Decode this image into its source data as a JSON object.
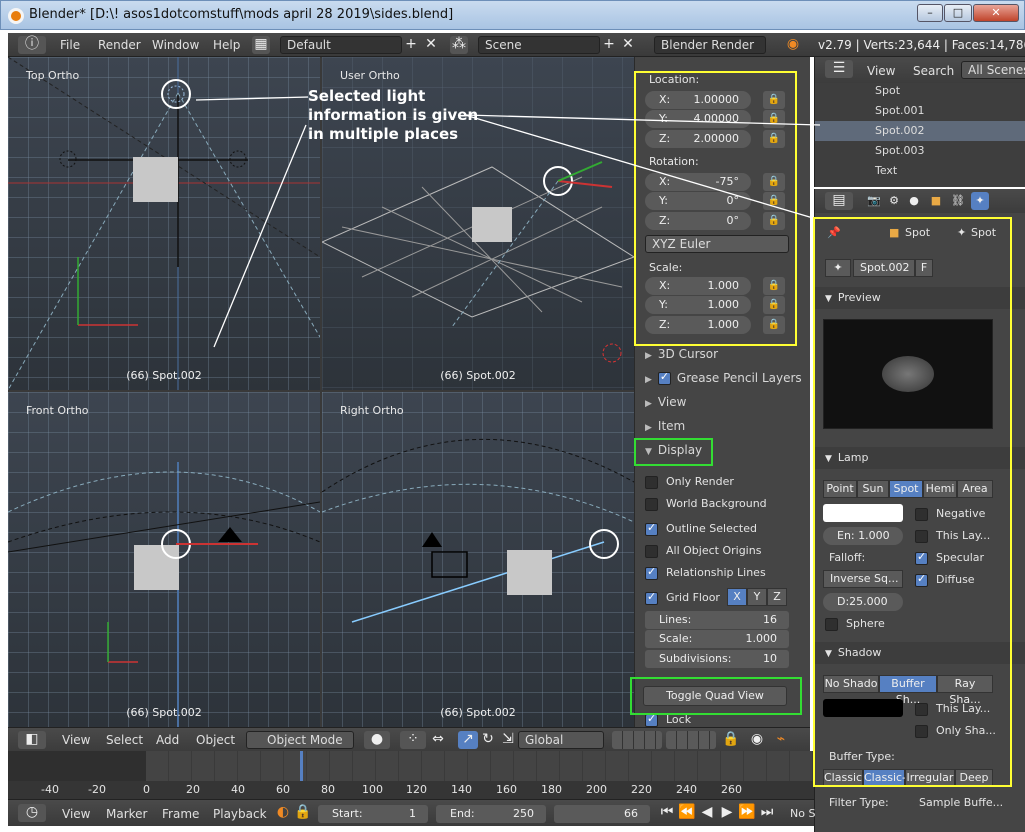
{
  "window": {
    "title": "Blender* [D:\\! asos1dotcomstuff\\mods april 28 2019\\sides.blend]"
  },
  "menubar": {
    "file": "File",
    "render": "Render",
    "window": "Window",
    "help": "Help",
    "layout": "Default",
    "scene": "Scene",
    "engine": "Blender Render",
    "stats": "v2.79 | Verts:23,644 | Faces:14,786 | Tri"
  },
  "viewports": {
    "top": "Top Ortho",
    "user": "User Ortho",
    "front": "Front Ortho",
    "right": "Right Ortho",
    "object_label": "(66) Spot.002"
  },
  "annotation": [
    "Selected light",
    "information is given",
    "in multiple places"
  ],
  "npanel": {
    "location_label": "Location:",
    "loc": [
      {
        "k": "X:",
        "v": "1.00000"
      },
      {
        "k": "Y:",
        "v": "4.00000"
      },
      {
        "k": "Z:",
        "v": "2.00000"
      }
    ],
    "rotation_label": "Rotation:",
    "rot": [
      {
        "k": "X:",
        "v": "-75°"
      },
      {
        "k": "Y:",
        "v": "0°"
      },
      {
        "k": "Z:",
        "v": "0°"
      }
    ],
    "rotation_mode": "XYZ Euler",
    "scale_label": "Scale:",
    "scale": [
      {
        "k": "X:",
        "v": "1.000"
      },
      {
        "k": "Y:",
        "v": "1.000"
      },
      {
        "k": "Z:",
        "v": "1.000"
      }
    ],
    "sections": {
      "cursor": "3D Cursor",
      "grease": "Grease Pencil Layers",
      "view": "View",
      "item": "Item",
      "display": "Display"
    },
    "display": {
      "only_render": "Only Render",
      "world_bg": "World Background",
      "outline": "Outline Selected",
      "all_origins": "All Object Origins",
      "rel_lines": "Relationship Lines",
      "grid_floor": "Grid Floor",
      "x": "X",
      "y": "Y",
      "z": "Z"
    },
    "lines_k": "Lines:",
    "lines_v": "16",
    "scale_k": "Scale:",
    "scale_v": "1.000",
    "subdiv_k": "Subdivisions:",
    "subdiv_v": "10",
    "toggle_quad": "Toggle Quad View",
    "lock": "Lock"
  },
  "outliner": {
    "view": "View",
    "search": "Search",
    "all_scenes": "All Scenes",
    "items": [
      "Spot",
      "Spot.001",
      "Spot.002",
      "Spot.003",
      "Text"
    ]
  },
  "props": {
    "crumb1": "Spot",
    "crumb2": "Spot",
    "datablock": "Spot.002",
    "fake": "F",
    "preview": "Preview",
    "lamp": "Lamp",
    "lamp_types": [
      "Point",
      "Sun",
      "Spot",
      "Hemi",
      "Area"
    ],
    "negative": "Negative",
    "this_layer": "This Lay...",
    "energy": "En: 1.000",
    "falloff": "Falloff:",
    "specular": "Specular",
    "falloff_type": "Inverse Sq...",
    "diffuse": "Diffuse",
    "distance": "D:25.000",
    "sphere": "Sphere",
    "shadow": "Shadow",
    "no_shadow": "No Shado",
    "buffer_shadow": "Buffer Sh...",
    "ray_shadow": "Ray Sha...",
    "shadow_this_layer": "This Lay...",
    "only_shadow": "Only Sha...",
    "buffer_type": "Buffer Type:",
    "buffer_types": [
      "Classic",
      "Classic-",
      "Irregular",
      "Deep"
    ],
    "filter_type": "Filter Type:",
    "sample_buffers": "Sample Buffe..."
  },
  "vpheader": {
    "view": "View",
    "select": "Select",
    "add": "Add",
    "object": "Object",
    "mode": "Object Mode",
    "pivot": "Global"
  },
  "timeline": {
    "ticks": [
      "-40",
      "-20",
      "0",
      "20",
      "40",
      "60",
      "80",
      "100",
      "120",
      "140",
      "160",
      "180",
      "200",
      "220",
      "240",
      "260"
    ],
    "view": "View",
    "marker": "Marker",
    "frame": "Frame",
    "playback": "Playback",
    "start_k": "Start:",
    "start_v": "1",
    "end_k": "End:",
    "end_v": "250",
    "current": "66",
    "no_sync": "No S"
  }
}
